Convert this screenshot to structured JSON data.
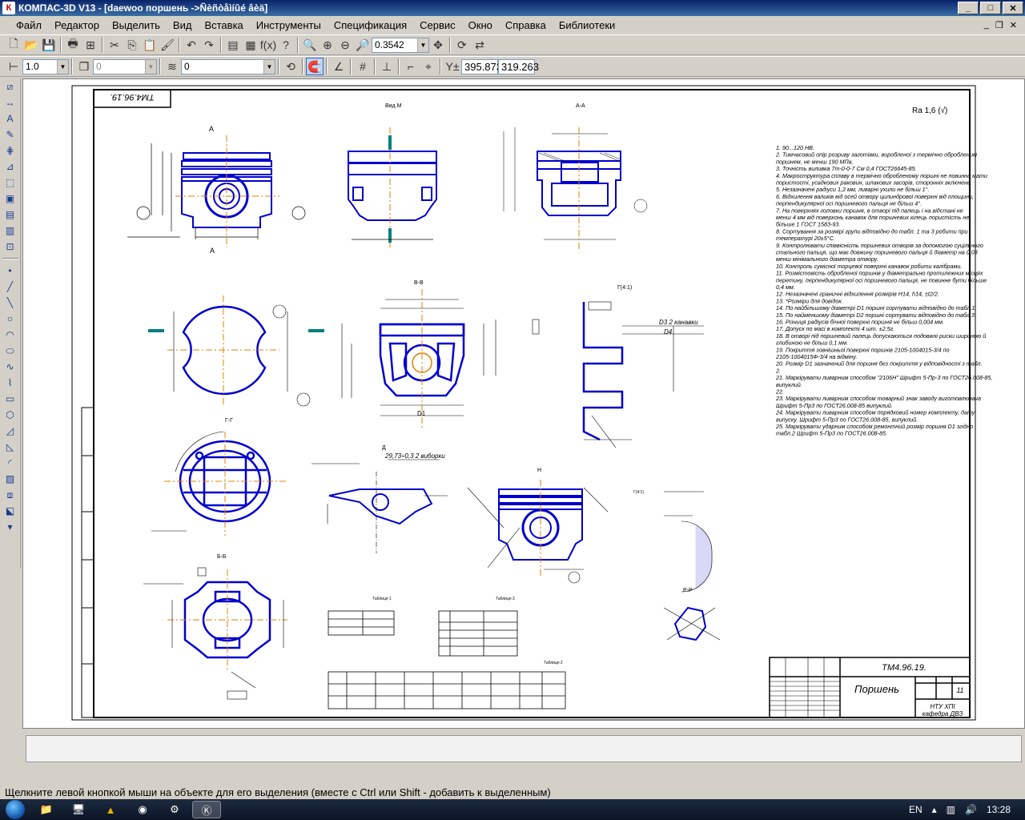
{
  "window": {
    "title": "КОМПАС-3D V13 - [daewoo поршень ->Ñèñòåìíûé âèä]"
  },
  "menu": [
    "Файл",
    "Редактор",
    "Выделить",
    "Вид",
    "Вставка",
    "Инструменты",
    "Спецификация",
    "Сервис",
    "Окно",
    "Справка",
    "Библиотеки"
  ],
  "toolbar": {
    "zoom": "0.3542",
    "coord_x": "395.873",
    "coord_y": "319.263",
    "line_scale": "1.0",
    "layer_field": "0",
    "style_field": "0"
  },
  "drawing": {
    "doc_code": "ТМ4.96.19.",
    "doc_code_rotated": "ТМ4.96.19.",
    "part_name": "Поршень",
    "sheet_number": "11",
    "org_line1": "НТУ ХПІ",
    "org_line2": "кафедра ДВЗ",
    "view_labels": [
      "Вид М",
      "А-А",
      "Б-Б",
      "В-В",
      "Г-Г",
      "Д",
      "Н",
      "Р-Р",
      "Г(4:1)"
    ],
    "table_title_1": "Таблиця 1",
    "table_title_2": "Таблиця 2",
    "table_title_3": "Таблиця 3",
    "roughness_symbol": "Ra 1,6 (√)",
    "callout_d3": "D3 2 канавки",
    "callout_d4": "D4",
    "callout_groove": "29,73÷0,3 2 виборки",
    "callout_d1": "D1",
    "notes": [
      "1. 90...120 HB.",
      "2. Тимчасовий опір розриву заготівки, виробленої з термічно обробленим поршнем, не менш 190 МПа.",
      "3. Точність виливка 7т-0-0-7 См 0,4 ГОСТ26645-85.",
      "4. Макроструктура сплаву в термічно обробленому поршні не повинна мати пористості, усадкових раковин, шлакових засорів, сторонніх включень.",
      "5. Незазначені радіуси 1,2 мм, ливарні ухили не більш 1°.",
      "6. Відхилення валиків від осей отвору цилиндрової поверхні від площини, перпендикулярної осі поршневого пальця не більш 4°.",
      "7. На поверхнях головки поршня, в отворі під палець і на відстані не менш 4 мм від поверхонь канавок для поршневих кілець пористість не більше 1 ГОСТ 1583-93.",
      "8. Сортування за розмірі групи відповідно до табл. 1 та 3 робити при температурі 20±5°С.",
      "9. Контролювати співвісність поршневих отворів за допомогою суцільного стального пальця, що має довжину поршневого пальця й діаметр на 0,03 менш мінімального діаметра отвору.",
      "10. Контроль сумісної торцевої поверхні канавок робити калібрами.",
      "11. Розмістовість обробленої поршнів у діаметрально протилежних місцях перетину, перпендикулярної осі поршневого пальця, не повинне бути більше 0,4 мм.",
      "12. Незазначені граничні відхилення розмірів Н14, h14, ±t2/2.",
      "13. *Розміри для довідок.",
      "14. По найбільшому діаметрі D1 поршні сортувати відповідно до табл.1.",
      "15. По найменшому діаметрі D2 поршні сортувати відповідно до табл.3.",
      "16. Різниця радіусів бічної поверхні поршня не більш 0,004 мм.",
      "17. Допуск по масі в комплекті 4 шт. ±2,5г.",
      "18. В отворі під поршневий палець допускаються подовжні риски шириною й глибиною не більш 0,1 мм.",
      "19. Покриття зовнішньої поверхні поршнів 2105-1004015-3/4 по 2105-1004015Ф-3/4 на відміну.",
      "20. Розмір D1 зазначений для поршня без покриття у відповідності з табл. 2.",
      "21. Маркірувати ливарним способом \"2106Н\" Шрифт 5-Пр-3 по ГОСТ26.008-85, випуклий.",
      "22.",
      "23. Маркірувати ливарним способом товарний знак заводу виготовлювача Шрифт 5-Пр3 по ГОСТ26.008-85 випуклий.",
      "24. Маркірувати ливарним способом порядковий номер комплекту, дату випуску. Шрифт 5-Пр3 по ГОСТ26.008-85, випуклий.",
      "25. Маркірувати ударним способом ремонтний розмір поршня D1 згідно табл.2 Шрифт 5-Пр3 по ГОСТ26.008-85."
    ]
  },
  "command_hint": "Щелкните левой кнопкой мыши на объекте для его выделения (вместе с Ctrl или Shift - добавить к выделенным)",
  "taskbar": {
    "lang": "EN",
    "time": "13:28"
  },
  "colors": {
    "drawing_blue": "#0000cc",
    "axis_orange": "#e08000",
    "axis_teal": "#008080"
  }
}
